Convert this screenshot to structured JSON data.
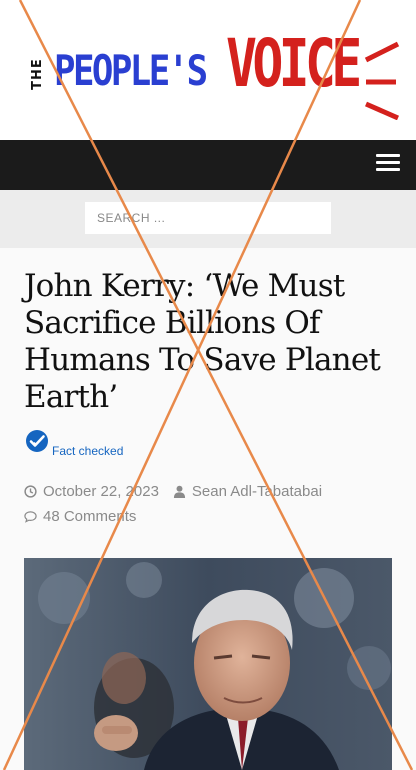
{
  "logo": {
    "the": "THE",
    "peoples": "PEOPLE'S",
    "voice": "VOICE",
    "colors": {
      "blue": "#2a3fd1",
      "red": "#d4211d"
    }
  },
  "nav": {
    "menu_icon": "hamburger-menu-icon"
  },
  "search": {
    "placeholder": "SEARCH ..."
  },
  "article": {
    "title": "John Kerry: ‘We Must Sacrifice Billions Of Humans To Save Planet Earth’",
    "fact_label": "Fact checked",
    "date": "October 22, 2023",
    "author": "Sean Adl-Tabatabai",
    "comments": "48 Comments",
    "icons": {
      "fact": "checkmark-badge-icon",
      "date": "clock-icon",
      "author": "user-icon",
      "comments": "comment-icon"
    }
  },
  "overlay": {
    "color": "#e8894a"
  }
}
